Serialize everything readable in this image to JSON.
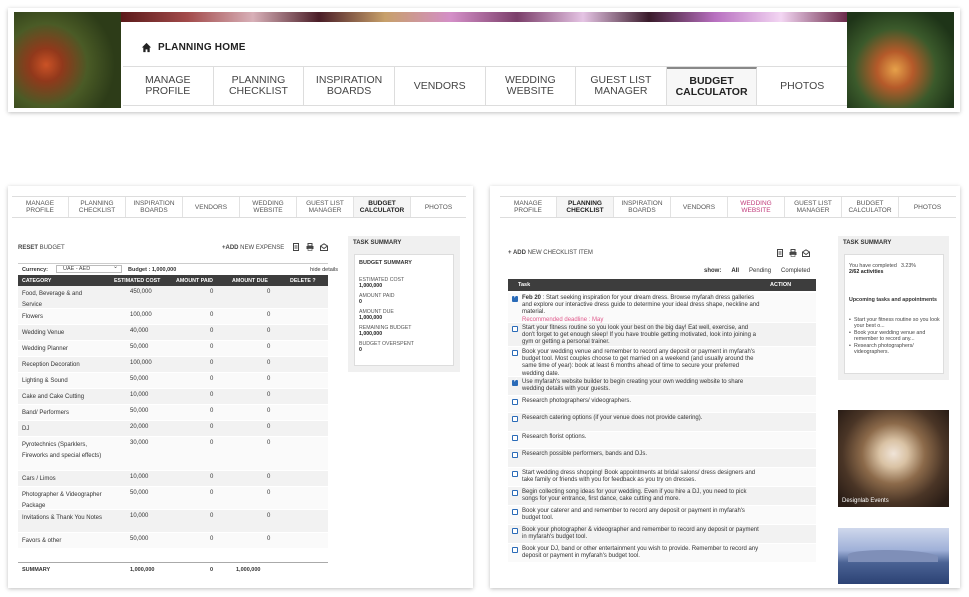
{
  "banner": {
    "home_label": "PLANNING HOME",
    "tabs": [
      {
        "label": "MANAGE\nPROFILE",
        "active": false
      },
      {
        "label": "PLANNING\nCHECKLIST",
        "active": false
      },
      {
        "label": "INSPIRATION\nBOARDS",
        "active": false
      },
      {
        "label": "VENDORS",
        "active": false
      },
      {
        "label": "WEDDING\nWEBSITE",
        "active": false
      },
      {
        "label": "GUEST LIST\nMANAGER",
        "active": false
      },
      {
        "label": "BUDGET\nCALCULATOR",
        "active": true
      },
      {
        "label": "PHOTOS",
        "active": false
      }
    ]
  },
  "budget": {
    "tabs": [
      {
        "label": "MANAGE\nPROFILE",
        "w": 57
      },
      {
        "label": "PLANNING\nCHECKLIST",
        "w": 57
      },
      {
        "label": "INSPIRATION\nBOARDS",
        "w": 57
      },
      {
        "label": "VENDORS",
        "w": 57
      },
      {
        "label": "WEDDING\nWEBSITE",
        "w": 57
      },
      {
        "label": "GUEST LIST\nMANAGER",
        "w": 57
      },
      {
        "label": "BUDGET\nCALCULATOR",
        "w": 57,
        "active": true
      },
      {
        "label": "PHOTOS",
        "w": 55
      }
    ],
    "reset_bold": "RESET",
    "reset_rest": " BUDGET",
    "add_bold": "+ADD",
    "add_rest": " NEW EXPENSE",
    "currency_label": "Currency:",
    "currency_value": "UAE - AED",
    "budget_label": "Budget : 1,000,000",
    "hide_details": "hide details",
    "columns": {
      "category": "CATEGORY",
      "estimated": "ESTIMATED COST",
      "paid": "AMOUNT PAID",
      "due": "AMOUNT DUE",
      "delete": "DELETE ?"
    },
    "rows": [
      {
        "category": "Food, Beverage & and Service",
        "estimated": "450,000",
        "paid": "0",
        "due": "0",
        "lines": 2
      },
      {
        "category": "Flowers",
        "estimated": "100,000",
        "paid": "0",
        "due": "0",
        "lines": 1
      },
      {
        "category": "Wedding Venue",
        "estimated": "40,000",
        "paid": "0",
        "due": "0",
        "lines": 1
      },
      {
        "category": "Wedding Planner",
        "estimated": "50,000",
        "paid": "0",
        "due": "0",
        "lines": 1
      },
      {
        "category": "Reception Decoration",
        "estimated": "100,000",
        "paid": "0",
        "due": "0",
        "lines": 1
      },
      {
        "category": "Lighting & Sound",
        "estimated": "50,000",
        "paid": "0",
        "due": "0",
        "lines": 1
      },
      {
        "category": "Cake and Cake Cutting",
        "estimated": "10,000",
        "paid": "0",
        "due": "0",
        "lines": 1
      },
      {
        "category": "Band/ Performers",
        "estimated": "50,000",
        "paid": "0",
        "due": "0",
        "lines": 1
      },
      {
        "category": "DJ",
        "estimated": "20,000",
        "paid": "0",
        "due": "0",
        "lines": 1
      },
      {
        "category": "Pyrotechnics (Sparklers, Fireworks and special effects)",
        "estimated": "30,000",
        "paid": "0",
        "due": "0",
        "lines": 3
      },
      {
        "category": "Cars / Limos",
        "estimated": "10,000",
        "paid": "0",
        "due": "0",
        "lines": 1
      },
      {
        "category": "Photographer & Videographer Package",
        "estimated": "50,000",
        "paid": "0",
        "due": "0",
        "lines": 2
      },
      {
        "category": "Invitations & Thank You Notes",
        "estimated": "10,000",
        "paid": "0",
        "due": "0",
        "lines": 2
      },
      {
        "category": "Favors & other",
        "estimated": "50,000",
        "paid": "0",
        "due": "0",
        "lines": 1
      }
    ],
    "summary": {
      "label": "SUMMARY",
      "estimated": "1,000,000",
      "paid": "0",
      "due": "1,000,000"
    },
    "side": {
      "header": "TASK SUMMARY",
      "title": "BUDGET SUMMARY",
      "items": [
        {
          "label": "ESTIMATED COST",
          "value": "1,000,000"
        },
        {
          "label": "AMOUNT PAID",
          "value": "0"
        },
        {
          "label": "AMOUNT DUE",
          "value": "1,000,000"
        },
        {
          "label": "REMAINING BUDGET",
          "value": "1,000,000"
        },
        {
          "label": "BUDGET OVERSPENT",
          "value": "0"
        }
      ]
    }
  },
  "checklist": {
    "tabs": [
      {
        "label": "MANAGE\nPROFILE",
        "w": 57
      },
      {
        "label": "PLANNING\nCHECKLIST",
        "w": 57,
        "active": true
      },
      {
        "label": "INSPIRATION\nBOARDS",
        "w": 57
      },
      {
        "label": "VENDORS",
        "w": 57
      },
      {
        "label": "WEDDING\nWEBSITE",
        "w": 57,
        "pink": true
      },
      {
        "label": "GUEST LIST\nMANAGER",
        "w": 57
      },
      {
        "label": "BUDGET\nCALCULATOR",
        "w": 57
      },
      {
        "label": "PHOTOS",
        "w": 57
      }
    ],
    "add_bold": "+ ADD",
    "add_rest": " NEW CHECKLIST ITEM",
    "show_label": "show:",
    "filters": [
      "All",
      "Pending",
      "Completed"
    ],
    "col_task": "Task",
    "col_action": "ACTION",
    "tasks": [
      {
        "date": "Feb 20",
        "text": " : Start seeking inspiration for your dream dress. Browse myfarah dress galleries and explore our interactive dress guide to determine your ideal dress shape, neckline and material.",
        "deadline": "Recommended deadline : May",
        "checked": true,
        "h": 30
      },
      {
        "date": "",
        "text": "Start your fitness routine so you look your best on the big day! Eat well, exercise, and don't forget to get enough sleep! If you have trouble getting motivated, look into joining a gym or getting a personal trainer.",
        "deadline": "",
        "checked": false,
        "h": 24
      },
      {
        "date": "",
        "text": "Book your wedding venue and remember to record any deposit or payment in myfarah's budget tool. Most couples choose to get married on a weekend (and usually around the same time of year): book at least 6 months ahead of time to secure your preferred wedding date.",
        "deadline": "",
        "checked": false,
        "h": 30
      },
      {
        "date": "",
        "text": "Use myfarah's website builder to begin creating your own wedding website to share wedding details with your guests.",
        "deadline": "",
        "checked": true,
        "h": 19
      },
      {
        "date": "",
        "text": "Research photographers/ videographers.",
        "deadline": "",
        "checked": false,
        "h": 17
      },
      {
        "date": "",
        "text": "Research catering options (if your venue does not provide catering).",
        "deadline": "",
        "checked": false,
        "h": 19
      },
      {
        "date": "",
        "text": "Research florist options.",
        "deadline": "",
        "checked": false,
        "h": 17
      },
      {
        "date": "",
        "text": "Research possible performers, bands and DJs.",
        "deadline": "",
        "checked": false,
        "h": 19
      },
      {
        "date": "",
        "text": "Start wedding dress shopping! Book appointments at bridal salons/ dress designers and take family or friends with you for feedback as you try on dresses.",
        "deadline": "",
        "checked": false,
        "h": 19
      },
      {
        "date": "",
        "text": "Begin collecting song ideas for your wedding. Even if you hire a DJ, you need to pick songs for your entrance, first dance, cake cutting and more.",
        "deadline": "",
        "checked": false,
        "h": 19
      },
      {
        "date": "",
        "text": "Book your caterer and and remember to record any deposit or payment in myfarah's budget tool.",
        "deadline": "",
        "checked": false,
        "h": 19
      },
      {
        "date": "",
        "text": "Book your photographer & videographer and remember to record any deposit or payment in myfarah's budget tool.",
        "deadline": "",
        "checked": false,
        "h": 19
      },
      {
        "date": "",
        "text": "Book your DJ, band or other entertainment you wish to provide. Remember to record any deposit or payment in myfarah's budget tool.",
        "deadline": "",
        "checked": false,
        "h": 19
      }
    ],
    "side": {
      "header": "TASK SUMMARY",
      "progress_text": "You have completed",
      "progress_count": "2/62 activities",
      "percent": "3.23%",
      "upcoming": "Upcoming tasks and appointments",
      "items": [
        "Start your fitness routine so you look your best o...",
        "Book your wedding venue and remember to record any...",
        "Research photographers/ videographers."
      ]
    },
    "ad_caption": "Designlab Events"
  }
}
